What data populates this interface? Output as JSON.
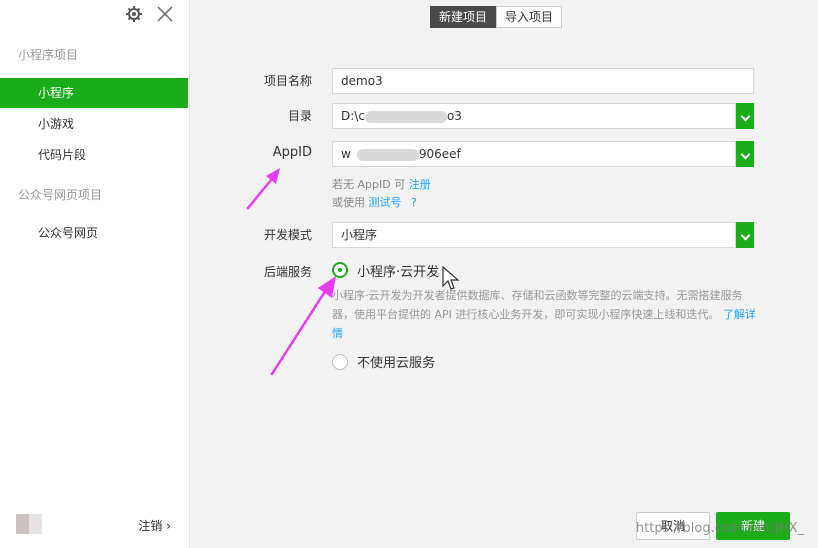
{
  "sidebar": {
    "section_miniprogram": "小程序项目",
    "items": [
      {
        "label": "小程序"
      },
      {
        "label": "小游戏"
      },
      {
        "label": "代码片段"
      }
    ],
    "section_official": "公众号网页项目",
    "official_item": "公众号网页",
    "logout": "注销 ›"
  },
  "tabs": [
    {
      "label": "新建项目"
    },
    {
      "label": "导入项目"
    }
  ],
  "form": {
    "project_name_label": "项目名称",
    "project_name_value": "demo3",
    "dir_label": "目录",
    "dir_value_start": "D:\\c",
    "dir_value_end": "o3",
    "appid_label": "AppID",
    "appid_value_start": "w",
    "appid_value_end": "906eef",
    "appid_hint_1": "若无 AppID 可",
    "appid_register": "注册",
    "appid_hint_2": "或使用",
    "appid_test": "测试号",
    "appid_help": "?",
    "mode_label": "开发模式",
    "mode_value": "小程序",
    "backend_label": "后端服务",
    "cloud_option": "小程序·云开发",
    "cloud_desc": "小程序·云开发为开发者提供数据库、存储和云函数等完整的云端支持。无需搭建服务器，使用平台提供的 API 进行核心业务开发，即可实现小程序快速上线和迭代。",
    "cloud_more": "了解详情",
    "no_cloud_option": "不使用云服务"
  },
  "buttons": {
    "cancel": "取消",
    "create": "新建"
  },
  "watermark": "https://blog.csdn.net/JHX_",
  "colors": {
    "accent": "#1aad19",
    "annotation_arrow": "#e63cf2",
    "link": "#1aa3ff"
  }
}
